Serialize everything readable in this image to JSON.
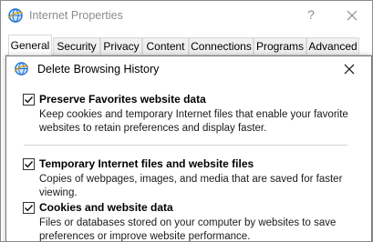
{
  "window": {
    "title": "Internet Properties",
    "help_glyph": "?"
  },
  "tabs": [
    {
      "label": "General",
      "active": true
    },
    {
      "label": "Security",
      "active": false
    },
    {
      "label": "Privacy",
      "active": false
    },
    {
      "label": "Content",
      "active": false
    },
    {
      "label": "Connections",
      "active": false
    },
    {
      "label": "Programs",
      "active": false
    },
    {
      "label": "Advanced",
      "active": false
    }
  ],
  "dialog": {
    "title": "Delete Browsing History",
    "options": [
      {
        "label": "Preserve Favorites website data",
        "checked": true,
        "desc_lines": [
          "Keep cookies and temporary Internet files that enable your favorite",
          "websites to retain preferences and display faster."
        ]
      },
      {
        "label": "Temporary Internet files and website files",
        "checked": true,
        "desc_lines": [
          "Copies of webpages, images, and media that are saved for faster",
          "viewing."
        ]
      },
      {
        "label": "Cookies and website data",
        "checked": true,
        "desc_lines": [
          "Files or databases stored on your computer by websites to save",
          "preferences or improve website performance."
        ]
      }
    ]
  },
  "icons": {
    "window_icon": "ie-globe-icon",
    "dialog_icon": "ie-globe-icon",
    "close": "close-icon",
    "check": "checkmark-icon"
  },
  "colors": {
    "title_gray": "#8c8c8c",
    "ie_blue": "#1e6fd0",
    "tab_bg": "#f0f0f0"
  }
}
